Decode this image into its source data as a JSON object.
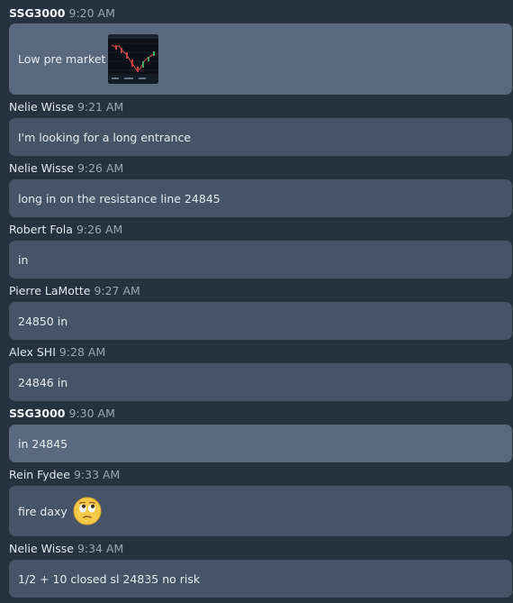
{
  "messages": [
    {
      "author": "SSG3000",
      "time": "9:20 AM",
      "text": "Low pre market",
      "admin": true,
      "highlight": true,
      "attachment": "chart-thumbnail"
    },
    {
      "author": "Nelie Wisse",
      "time": "9:21 AM",
      "text": "I'm looking for a long entrance"
    },
    {
      "author": "Nelie Wisse",
      "time": "9:26 AM",
      "text": "long in on the resistance line 24845"
    },
    {
      "author": "Robert Fola",
      "time": "9:26 AM",
      "text": "in"
    },
    {
      "author": "Pierre LaMotte",
      "time": "9:27 AM",
      "text": "24850 in"
    },
    {
      "author": "Alex SHI",
      "time": "9:28 AM",
      "text": "24846 in"
    },
    {
      "author": "SSG3000",
      "time": "9:30 AM",
      "text": "in 24845",
      "admin": true,
      "highlight": true
    },
    {
      "author": "Rein Fydee",
      "time": "9:33 AM",
      "text": "fire daxy",
      "emoji": "face-with-rolling-eyes-emoji"
    },
    {
      "author": "Nelie Wisse",
      "time": "9:34 AM",
      "text": "1/2 + 10 closed sl 24835 no risk"
    }
  ],
  "colors": {
    "background": "#263240",
    "bubble": "#455567",
    "bubble_highlight": "#5a6a7e",
    "timestamp": "#9aa6b3"
  }
}
